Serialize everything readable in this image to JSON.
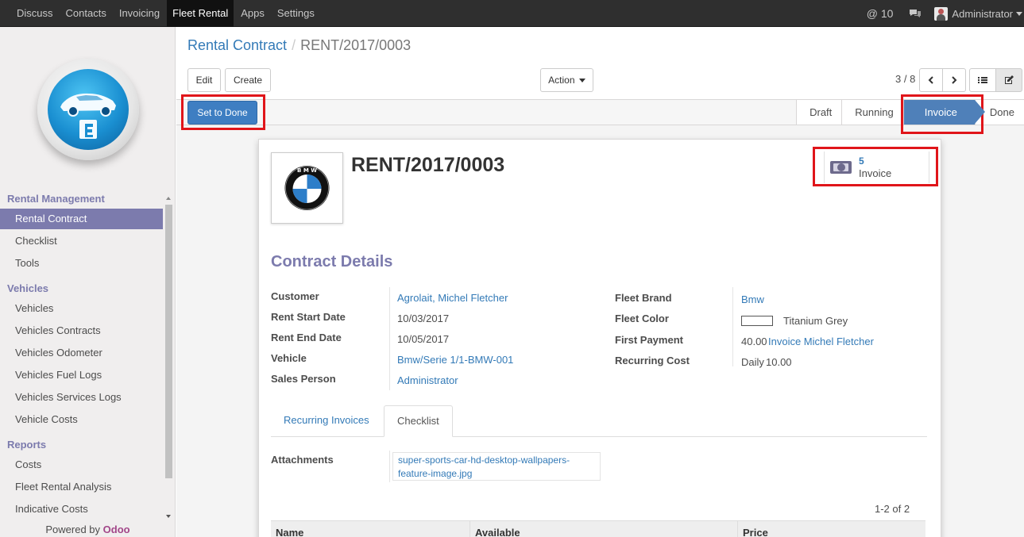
{
  "topbar": {
    "menu": [
      "Discuss",
      "Contacts",
      "Invoicing",
      "Fleet Rental",
      "Apps",
      "Settings"
    ],
    "active_menu": "Fleet Rental",
    "mentions": "@ 10",
    "user": "Administrator"
  },
  "sidebar": {
    "sections": [
      {
        "title": "Rental Management",
        "items": [
          "Rental Contract",
          "Checklist",
          "Tools"
        ]
      },
      {
        "title": "Vehicles",
        "items": [
          "Vehicles",
          "Vehicles Contracts",
          "Vehicles Odometer",
          "Vehicles Fuel Logs",
          "Vehicles Services Logs",
          "Vehicle Costs"
        ]
      },
      {
        "title": "Reports",
        "items": [
          "Costs",
          "Fleet Rental Analysis",
          "Indicative Costs"
        ]
      }
    ],
    "active_item": "Rental Contract",
    "powered_by": "Powered by",
    "powered_brand": "Odoo"
  },
  "control_panel": {
    "breadcrumb_parent": "Rental Contract",
    "breadcrumb_current": "RENT/2017/0003",
    "edit_label": "Edit",
    "create_label": "Create",
    "action_label": "Action",
    "pager": "3 / 8"
  },
  "statusbar": {
    "set_done_label": "Set to Done",
    "stages": [
      "Draft",
      "Running",
      "Invoice",
      "Done"
    ],
    "current_stage": "Invoice"
  },
  "form": {
    "title": "RENT/2017/0003",
    "smart_button": {
      "count": "5",
      "label": "Invoice"
    },
    "section_title": "Contract Details",
    "left_fields": [
      {
        "label": "Customer",
        "value": "Agrolait, Michel Fletcher",
        "link": true
      },
      {
        "label": "Rent Start Date",
        "value": "10/03/2017",
        "link": false
      },
      {
        "label": "Rent End Date",
        "value": "10/05/2017",
        "link": false
      },
      {
        "label": "Vehicle",
        "value": "Bmw/Serie 1/1-BMW-001",
        "link": true
      },
      {
        "label": "Sales Person",
        "value": "Administrator",
        "link": true
      }
    ],
    "right_fields": {
      "fleet_brand_label": "Fleet Brand",
      "fleet_brand": "Bmw",
      "fleet_color_label": "Fleet Color",
      "fleet_color": "Titanium Grey",
      "first_payment_label": "First Payment",
      "first_payment_amount": "40.00",
      "first_payment_invoice": "Invoice Michel Fletcher",
      "recurring_cost_label": "Recurring Cost",
      "recurring_period": "Daily",
      "recurring_amount": "10.00"
    },
    "tabs": [
      "Recurring Invoices",
      "Checklist"
    ],
    "active_tab": "Checklist",
    "attachments_label": "Attachments",
    "attachment_line1": "super-sports-car-hd-desktop-wallpapers-",
    "attachment_line2": "feature-image.jpg",
    "records_count": "1-2 of 2",
    "columns": [
      "Name",
      "Available",
      "Price"
    ]
  },
  "colors": {
    "accent": "#7c7bad",
    "link": "#337ab7",
    "primary_button": "#3e7ec2",
    "highlight": "#e0151a"
  }
}
